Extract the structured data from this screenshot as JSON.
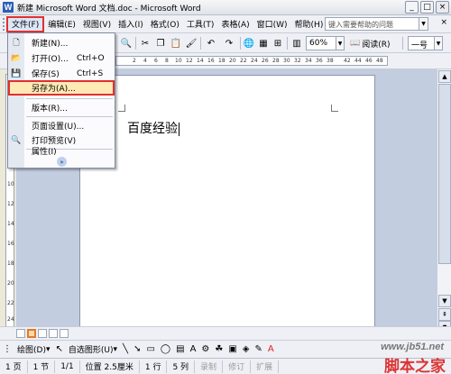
{
  "window": {
    "title": "新建 Microsoft Word 文档.doc - Microsoft Word",
    "app_icon_letter": "W",
    "buttons": [
      "_",
      "□",
      "×"
    ]
  },
  "menubar": {
    "items": [
      "文件(F)",
      "编辑(E)",
      "视图(V)",
      "插入(I)",
      "格式(O)",
      "工具(T)",
      "表格(A)",
      "窗口(W)",
      "帮助(H)"
    ],
    "help_placeholder": "键入需要帮助的问题",
    "close": "×"
  },
  "toolbar": {
    "zoom": "60%",
    "read_label": "阅读(R)",
    "style_value": "一号"
  },
  "ruler": {
    "numbers": [
      "2",
      "4",
      "6",
      "8",
      "10",
      "12",
      "14",
      "16",
      "18",
      "20",
      "22",
      "24",
      "26",
      "28",
      "30",
      "32",
      "34",
      "36",
      "38",
      "42",
      "44",
      "46",
      "48"
    ]
  },
  "vruler": {
    "numbers": [
      "2",
      "4",
      "6",
      "8",
      "10",
      "12",
      "14",
      "16",
      "18",
      "20",
      "22",
      "24",
      "26"
    ]
  },
  "document": {
    "text": "百度经验"
  },
  "file_menu": {
    "items": [
      {
        "label": "新建(N)...",
        "shortcut": ""
      },
      {
        "label": "打开(O)...",
        "shortcut": "Ctrl+O"
      },
      {
        "label": "保存(S)",
        "shortcut": "Ctrl+S"
      },
      {
        "label": "另存为(A)...",
        "shortcut": ""
      },
      {
        "label": "版本(R)...",
        "shortcut": ""
      },
      {
        "label": "页面设置(U)...",
        "shortcut": ""
      },
      {
        "label": "打印预览(V)",
        "shortcut": ""
      },
      {
        "label": "属性(I)",
        "shortcut": ""
      }
    ],
    "more": "»"
  },
  "drawbar": {
    "draw_label": "绘图(D)",
    "autoshape_label": "自选图形(U)"
  },
  "statusbar": {
    "page": "1 页",
    "section": "1 节",
    "pages": "1/1",
    "position": "位置 2.5厘米",
    "line": "1 行",
    "column": "5 列",
    "rec": "录制",
    "trk": "修订",
    "ext": "扩展"
  },
  "watermark": {
    "site": "www.jb51.net",
    "brand": "脚本之家"
  }
}
